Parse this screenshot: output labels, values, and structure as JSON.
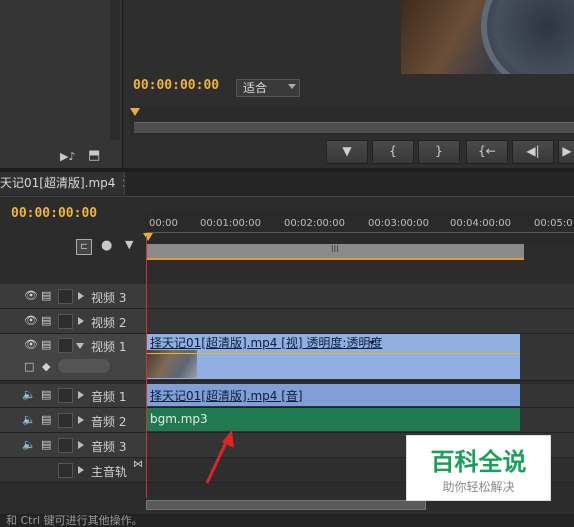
{
  "monitor": {
    "timecode": "00:00:00:00",
    "fit_label": "适合"
  },
  "transport": {
    "btn_marker": "▼",
    "btn_in": "{",
    "btn_out": "}",
    "btn_goto_in": "{←",
    "btn_step_back": "◀|",
    "btn_play": "▶"
  },
  "sequence_tab": {
    "label": "天记01[超清版].mp4",
    "close": "×"
  },
  "timeline": {
    "timecode": "00:00:00:00",
    "ruler_labels": [
      "00:00",
      "00:01:00:00",
      "00:02:00:00",
      "00:03:00:00",
      "00:04:00:00",
      "00:05:0"
    ],
    "work_area_grip": "III"
  },
  "tracks": {
    "video3": "视频 3",
    "video2": "视频 2",
    "video1": "视频 1",
    "audio1": "音频 1",
    "audio2": "音频 2",
    "audio3": "音频 3",
    "master": "主音轨"
  },
  "clips": {
    "video_clip": "择天记01[超清版].mp4 [视] 透明度:透明度",
    "audio_clip": "择天记01[超清版].mp4 [音]",
    "bgm_clip": "bgm.mp3"
  },
  "colors": {
    "video_clip": "#8fb0e0",
    "audio_clip": "#7f9fd6",
    "bgm_clip": "#1f7a4f",
    "timecode": "#f0b43c",
    "arrow": "#e02424"
  },
  "status": {
    "text": "和 Ctrl 键可进行其他操作。"
  },
  "watermark": {
    "title": "百科全说",
    "subtitle": "助你轻松解决"
  }
}
